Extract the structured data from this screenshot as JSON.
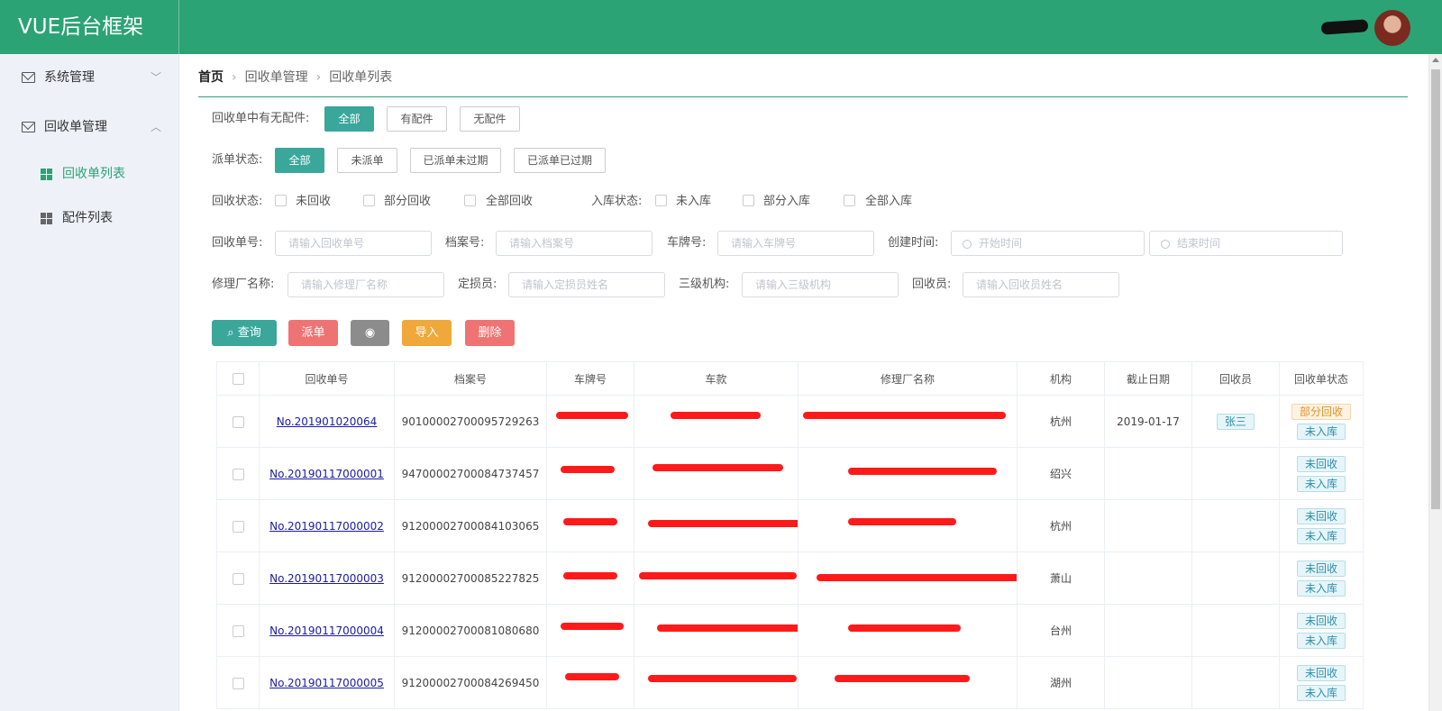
{
  "app": {
    "title": "VUE后台框架"
  },
  "sidebar": {
    "menus": [
      {
        "label": "系统管理",
        "arrow": "﹀"
      },
      {
        "label": "回收单管理",
        "arrow": "︿"
      }
    ],
    "subitems": [
      {
        "label": "回收单列表"
      },
      {
        "label": "配件列表"
      }
    ]
  },
  "breadcrumb": {
    "home": "首页",
    "level1": "回收单管理",
    "level2": "回收单列表"
  },
  "filters": {
    "parts_label": "回收单中有无配件:",
    "parts_options": [
      "全部",
      "有配件",
      "无配件"
    ],
    "dispatch_label": "派单状态:",
    "dispatch_options": [
      "全部",
      "未派单",
      "已派单未过期",
      "已派单已过期"
    ],
    "recycle_label": "回收状态:",
    "recycle_options": [
      "未回收",
      "部分回收",
      "全部回收"
    ],
    "storage_label": "入库状态:",
    "storage_options": [
      "未入库",
      "部分入库",
      "全部入库"
    ],
    "order_no": {
      "label": "回收单号:",
      "placeholder": "请输入回收单号"
    },
    "archive_no": {
      "label": "档案号:",
      "placeholder": "请输入档案号"
    },
    "plate_no": {
      "label": "车牌号:",
      "placeholder": "请输入车牌号"
    },
    "created": {
      "label": "创建时间:",
      "start_placeholder": "开始时间",
      "end_placeholder": "结束时间"
    },
    "factory": {
      "label": "修理厂名称:",
      "placeholder": "请输入修理厂名称"
    },
    "assessor": {
      "label": "定损员:",
      "placeholder": "请输入定损员姓名"
    },
    "org3": {
      "label": "三级机构:",
      "placeholder": "请输入三级机构"
    },
    "recycler": {
      "label": "回收员:",
      "placeholder": "请输入回收员姓名"
    }
  },
  "actions": {
    "search": "查询",
    "dispatch": "派单",
    "view": "◉",
    "import": "导入",
    "delete": "删除"
  },
  "colors": {
    "primary": "#2ba375",
    "teal": "#3aa79a",
    "red": "#f07373",
    "gray": "#8c8c8c",
    "orange": "#f0a83a"
  },
  "table": {
    "headers": [
      "回收单号",
      "档案号",
      "车牌号",
      "车款",
      "修理厂名称",
      "机构",
      "截止日期",
      "回收员",
      "回收单状态"
    ],
    "rows": [
      {
        "order": "No.201901020064",
        "archive": "90100002700095729263",
        "org": "杭州",
        "deadline": "2019-01-17",
        "recycler": "张三",
        "status1": "部分回收",
        "status2": "未入库"
      },
      {
        "order": "No.20190117000001",
        "archive": "94700002700084737457",
        "org": "绍兴",
        "deadline": "",
        "recycler": "",
        "status1": "未回收",
        "status2": "未入库"
      },
      {
        "order": "No.20190117000002",
        "archive": "91200002700084103065",
        "org": "杭州",
        "deadline": "",
        "recycler": "",
        "status1": "未回收",
        "status2": "未入库"
      },
      {
        "order": "No.20190117000003",
        "archive": "91200002700085227825",
        "org": "萧山",
        "deadline": "",
        "recycler": "",
        "status1": "未回收",
        "status2": "未入库"
      },
      {
        "order": "No.20190117000004",
        "archive": "91200002700081080680",
        "org": "台州",
        "deadline": "",
        "recycler": "",
        "status1": "未回收",
        "status2": "未入库"
      },
      {
        "order": "No.20190117000005",
        "archive": "91200002700084269450",
        "org": "湖州",
        "deadline": "",
        "recycler": "",
        "status1": "未回收",
        "status2": "未入库"
      }
    ]
  }
}
